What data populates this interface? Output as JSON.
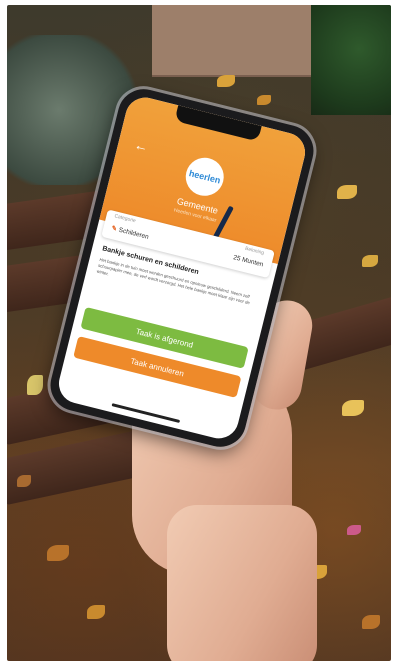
{
  "app": {
    "logo_text": "heerlen",
    "municipality": "Gemeente",
    "subtitle": "Heerlen voor elkaar",
    "back_icon": "arrow-left-icon"
  },
  "task_card": {
    "category_label": "Categorie",
    "category_value": "Schilderen",
    "reward_label": "Beloning",
    "reward_value": "25 Munten"
  },
  "task": {
    "title": "Bankje schuren en schilderen",
    "description": "Het bankje in de tuin moet worden geschuurd en opnieuw geschilderd. Neem zelf schuurpapier mee, de verf wordt verzorgd. Het hele bankje moet klaar zijn voor de winter."
  },
  "buttons": {
    "complete": "Taak is afgerond",
    "cancel": "Taak annuleren"
  },
  "colors": {
    "header": "#ee8a2a",
    "complete": "#7dbb41",
    "cancel": "#ee8a2a",
    "logo_text": "#2e8ad6"
  }
}
